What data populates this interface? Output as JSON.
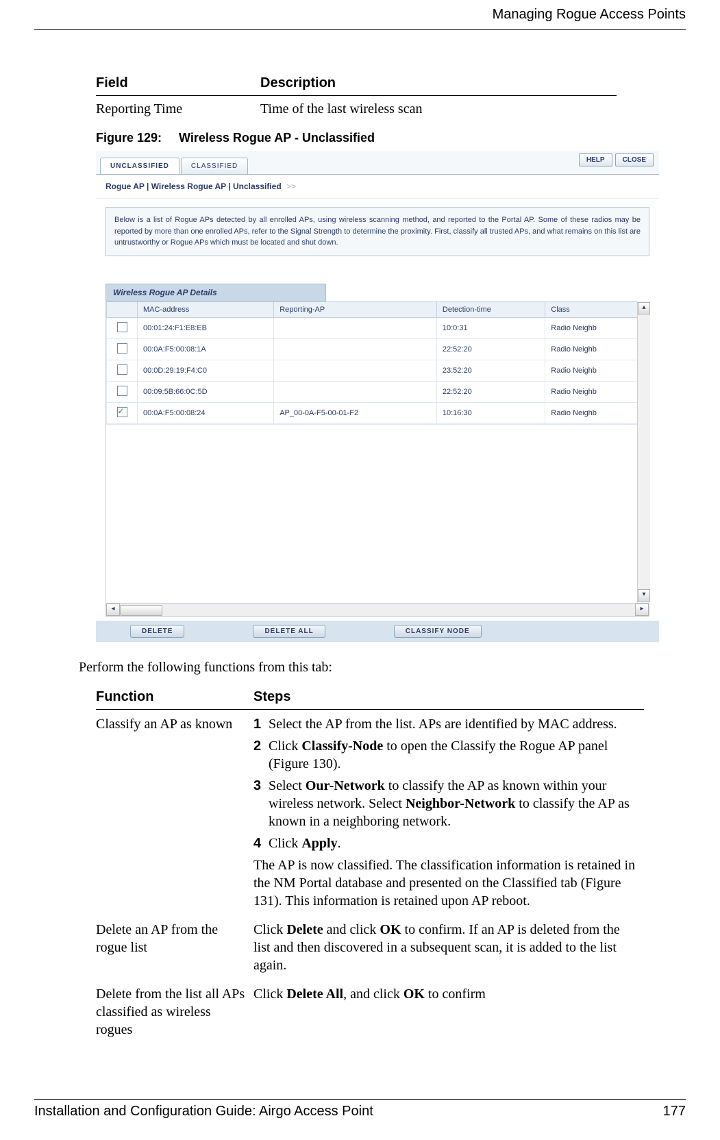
{
  "header": {
    "title": "Managing Rogue Access Points"
  },
  "fieldTable": {
    "headers": {
      "field": "Field",
      "desc": "Description"
    },
    "row": {
      "field": "Reporting Time",
      "desc": "Time of the last wireless scan"
    }
  },
  "figure": {
    "number": "Figure 129:",
    "title": "Wireless Rogue AP - Unclassified"
  },
  "screenshot": {
    "tabs": {
      "unclassified": "UNCLASSIFIED",
      "classified": "CLASSIFIED"
    },
    "toolbar": {
      "help": "HELP",
      "close": "CLOSE"
    },
    "breadcrumb": "Rogue AP | Wireless Rogue AP | Unclassified",
    "breadcrumbArrows": ">>",
    "infoText": "Below is a list of Rogue APs detected by all enrolled APs, using wireless scanning method, and reported to the Portal AP. Some of these radios may be reported by more than one enrolled APs, refer to the Signal Strength to determine the proximity. First, classify all trusted APs, and what remains on this list are untrustworthy or Rogue APs which must be located and shut down.",
    "panelTitle": "Wireless Rogue AP Details",
    "gridHeaders": {
      "mac": "MAC-address",
      "reporting": "Reporting-AP",
      "time": "Detection-time",
      "class": "Class"
    },
    "rows": [
      {
        "checked": false,
        "mac": "00:01:24:F1:E8:EB",
        "reporting": "",
        "time": "10:0:31",
        "class": "Radio Neighb"
      },
      {
        "checked": false,
        "mac": "00:0A:F5:00:08:1A",
        "reporting": "",
        "time": "22:52:20",
        "class": "Radio Neighb"
      },
      {
        "checked": false,
        "mac": "00:0D:29:19:F4:C0",
        "reporting": "",
        "time": "23:52:20",
        "class": "Radio Neighb"
      },
      {
        "checked": false,
        "mac": "00:09:5B:66:0C:5D",
        "reporting": "",
        "time": "22:52:20",
        "class": "Radio Neighb"
      },
      {
        "checked": true,
        "mac": "00:0A:F5:00:08:24",
        "reporting": "AP_00-0A-F5-00-01-F2",
        "time": "10:16:30",
        "class": "Radio Neighb"
      }
    ],
    "buttons": {
      "delete": "DELETE",
      "deleteAll": "DELETE ALL",
      "classify": "CLASSIFY NODE"
    }
  },
  "bodyText": "Perform the following functions from this tab:",
  "funcTable": {
    "headers": {
      "func": "Function",
      "steps": "Steps"
    },
    "r1": {
      "func": "Classify an AP as known",
      "step1": "Select the AP from the list. APs are identified by MAC address.",
      "step2a": "Click ",
      "step2b": "Classify-Node",
      "step2c": " to open the Classify the Rogue AP panel (Figure 130).",
      "step3a": "Select ",
      "step3b": "Our-Network",
      "step3c": " to classify the AP as known within your wireless network. Select ",
      "step3d": "Neighbor-Network",
      "step3e": " to classify the AP as known in a neighboring network.",
      "step4a": "Click ",
      "step4b": "Apply",
      "step4c": ".",
      "note": "The AP is now classified. The classification information is retained in the NM Portal database and presented on the Classified tab (Figure 131). This information is retained upon AP reboot."
    },
    "r2": {
      "func": "Delete an AP from the rogue list",
      "stepsA": "Click ",
      "stepsB": "Delete",
      "stepsC": " and click ",
      "stepsD": "OK",
      "stepsE": " to confirm. If an AP is deleted from the list and then discovered in a subsequent scan, it is added to the list again."
    },
    "r3": {
      "func": "Delete from the list all APs classified as wireless rogues",
      "stepsA": "Click ",
      "stepsB": "Delete All",
      "stepsC": ", and click ",
      "stepsD": "OK",
      "stepsE": " to confirm"
    }
  },
  "footer": {
    "left": "Installation and Configuration Guide: Airgo Access Point",
    "right": "177"
  }
}
